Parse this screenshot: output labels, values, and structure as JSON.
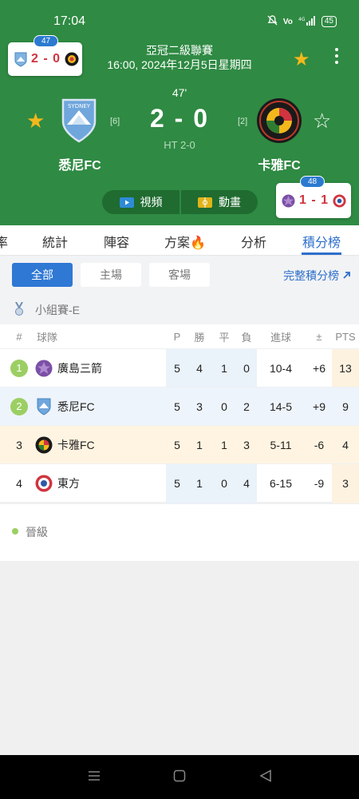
{
  "status_bar": {
    "time": "17:04",
    "battery": "45"
  },
  "colors": {
    "header_green": "#2f8a43",
    "accent_blue": "#2e6fcb",
    "score_red": "#d0343f",
    "star_gold": "#f4b81c",
    "qualify_green": "#9bcf63"
  },
  "left_mini": {
    "badge": "47",
    "score": "2 - 0"
  },
  "right_mini": {
    "badge": "48",
    "score": "1 - 1"
  },
  "match": {
    "competition": "亞冠二級聯賽",
    "datetime": "16:00, 2024年12月5日星期四",
    "minute": "47'",
    "score": "2 - 0",
    "halftime": "HT 2-0",
    "home": {
      "name": "悉尼FC",
      "rank": "[6]",
      "favorite_icon": "star-filled"
    },
    "away": {
      "name": "卡雅FC",
      "rank": "[2]",
      "favorite_icon": "star-outline"
    }
  },
  "media": {
    "video": "視頻",
    "animation": "動畫"
  },
  "tabs": [
    "率",
    "統計",
    "陣容",
    "方案",
    "分析",
    "積分榜"
  ],
  "filters": {
    "all": "全部",
    "home": "主場",
    "away": "客場",
    "full_standings": "完整積分榜"
  },
  "group_label": "小組賽-E",
  "table": {
    "headers": {
      "rank": "#",
      "team": "球隊",
      "p": "P",
      "w": "勝",
      "d": "平",
      "l": "負",
      "goals": "進球",
      "diff": "±",
      "pts": "PTS"
    },
    "rows": [
      {
        "pos": "1",
        "team": "廣島三箭",
        "p": "5",
        "w": "4",
        "d": "1",
        "l": "0",
        "goals": "10-4",
        "diff": "+6",
        "pts": "13"
      },
      {
        "pos": "2",
        "team": "悉尼FC",
        "p": "5",
        "w": "3",
        "d": "0",
        "l": "2",
        "goals": "14-5",
        "diff": "+9",
        "pts": "9"
      },
      {
        "pos": "3",
        "team": "卡雅FC",
        "p": "5",
        "w": "1",
        "d": "1",
        "l": "3",
        "goals": "5-11",
        "diff": "-6",
        "pts": "4"
      },
      {
        "pos": "4",
        "team": "東方",
        "p": "5",
        "w": "1",
        "d": "0",
        "l": "4",
        "goals": "6-15",
        "diff": "-9",
        "pts": "3"
      }
    ]
  },
  "legend": {
    "qualify": "晉級"
  }
}
